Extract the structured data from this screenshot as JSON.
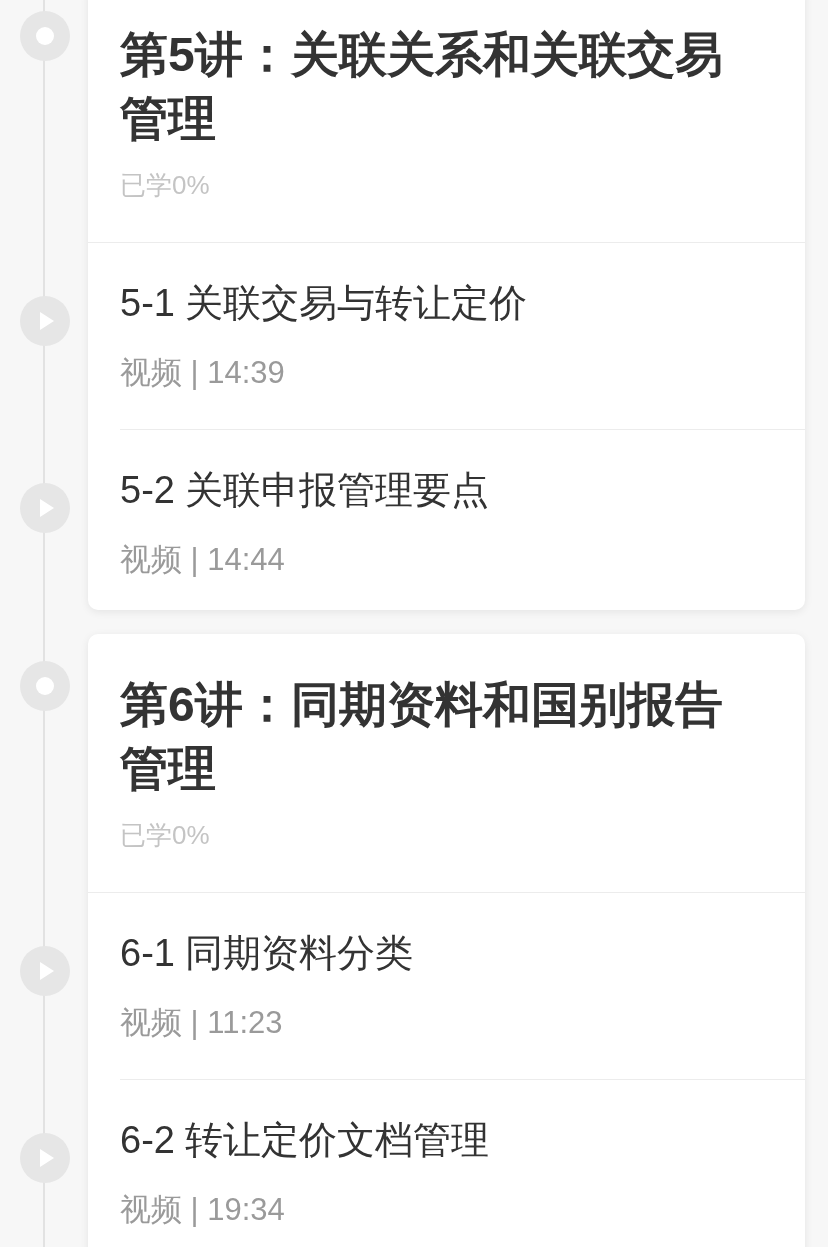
{
  "chapters": [
    {
      "title": "第5讲：关联关系和关联交易管理",
      "progress": "已学0%",
      "lessons": [
        {
          "title": "5-1 关联交易与转让定价",
          "meta": "视频 | 14:39"
        },
        {
          "title": "5-2 关联申报管理要点",
          "meta": "视频 | 14:44"
        }
      ]
    },
    {
      "title": "第6讲：同期资料和国别报告管理",
      "progress": "已学0%",
      "lessons": [
        {
          "title": "6-1 同期资料分类",
          "meta": "视频 | 11:23"
        },
        {
          "title": "6-2 转让定价文档管理",
          "meta": "视频 | 19:34"
        }
      ]
    }
  ]
}
